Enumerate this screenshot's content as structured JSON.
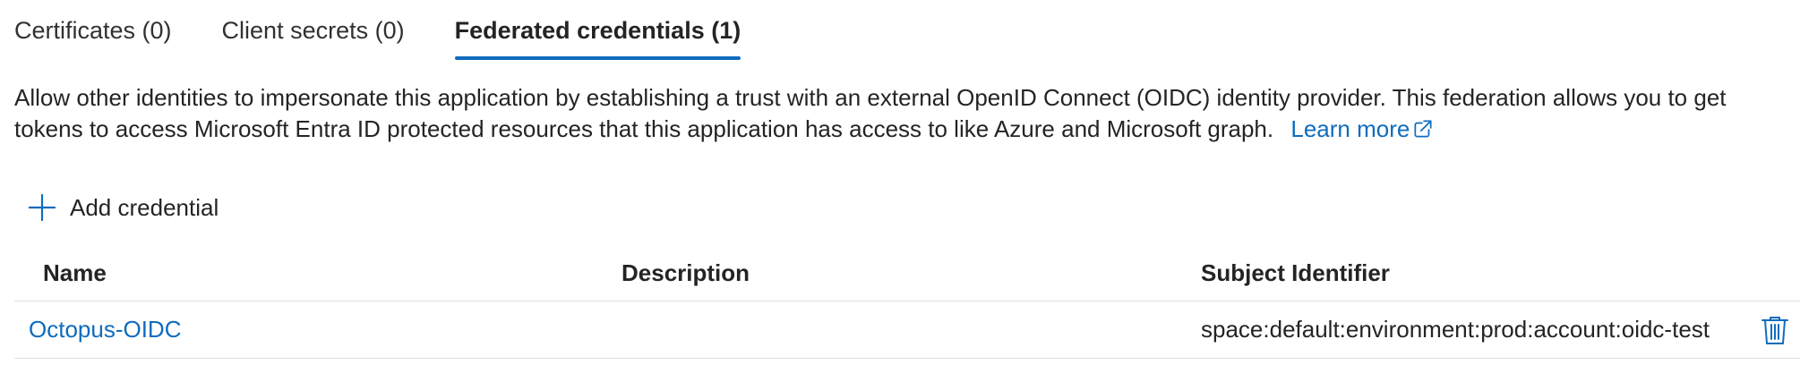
{
  "tabs": [
    {
      "label": "Certificates (0)",
      "active": false
    },
    {
      "label": "Client secrets (0)",
      "active": false
    },
    {
      "label": "Federated credentials (1)",
      "active": true
    }
  ],
  "description": {
    "text": "Allow other identities to impersonate this application by establishing a trust with an external OpenID Connect (OIDC) identity provider. This federation allows you to get tokens to access Microsoft Entra ID protected resources that this application has access to like Azure and Microsoft graph.",
    "learn_more": "Learn more",
    "learn_more_icon": "external-link-icon"
  },
  "toolbar": {
    "add_label": "Add credential",
    "add_icon": "plus-icon"
  },
  "table": {
    "columns": [
      "Name",
      "Description",
      "Subject Identifier"
    ],
    "rows": [
      {
        "name": "Octopus-OIDC",
        "description": "",
        "subject": "space:default:environment:prod:account:oidc-test",
        "action_icon": "trash-icon"
      }
    ]
  },
  "colors": {
    "accent": "#0f6cbd",
    "text": "#242424",
    "divider": "#e1dfdd"
  }
}
